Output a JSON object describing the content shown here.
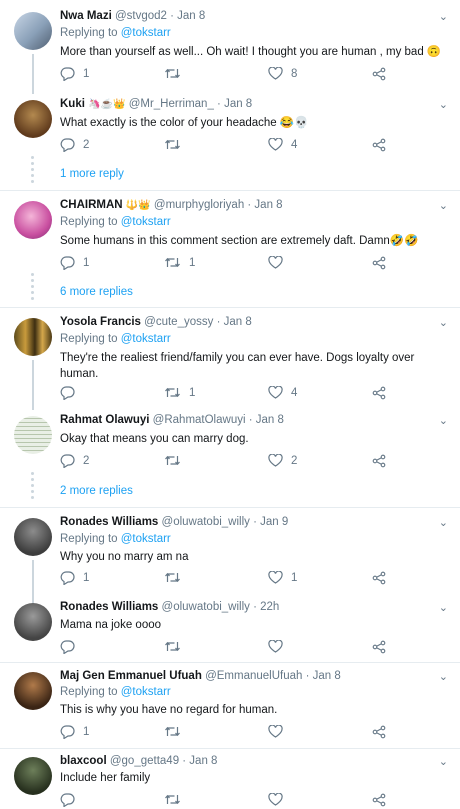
{
  "icons": {
    "reply": "speech-bubble-icon",
    "retweet": "retweet-arrows-icon",
    "like": "heart-icon",
    "share": "share-nodes-icon",
    "menu": "chevron-down-icon"
  },
  "colors": {
    "link": "#1da1f2",
    "secondary": "#657786",
    "divider": "#e6ecf0"
  },
  "tweets": [
    {
      "name": "Nwa Mazi",
      "emoji": "",
      "handle": "@stvgod2 · Jan 8",
      "replying_label": "Replying to",
      "replying_to": "@tokstarr",
      "text": "More than yourself as well... Oh wait!  I thought you are human , my bad 🙃",
      "replies": "1",
      "retweets": "",
      "likes": "8"
    },
    {
      "name": "Kuki",
      "emoji": "🦄☕👑",
      "handle": "@Mr_Herriman_ · Jan 8",
      "replying_label": "",
      "replying_to": "",
      "text": "What exactly is the color of your headache 😂💀",
      "replies": "2",
      "retweets": "",
      "likes": "4",
      "more": "1 more reply"
    },
    {
      "name": "CHAIRMAN",
      "emoji": "🔱👑",
      "handle": "@murphygloriyah · Jan 8",
      "replying_label": "Replying to",
      "replying_to": "@tokstarr",
      "text": "Some humans in this comment section are extremely daft. Damn🤣🤣",
      "replies": "1",
      "retweets": "1",
      "likes": "",
      "more": "6 more replies"
    },
    {
      "name": "Yosola Francis",
      "emoji": "",
      "handle": "@cute_yossy · Jan 8",
      "replying_label": "Replying to",
      "replying_to": "@tokstarr",
      "text": "They're the realiest friend/family you can ever have. Dogs loyalty over human.",
      "replies": "",
      "retweets": "1",
      "likes": "4"
    },
    {
      "name": "Rahmat Olawuyi",
      "emoji": "",
      "handle": "@RahmatOlawuyi · Jan 8",
      "replying_label": "",
      "replying_to": "",
      "text": "Okay that means you can marry dog.",
      "replies": "2",
      "retweets": "",
      "likes": "2",
      "more": "2 more replies"
    },
    {
      "name": "Ronades Williams",
      "emoji": "",
      "handle": "@oluwatobi_willy · Jan 9",
      "replying_label": "Replying to",
      "replying_to": "@tokstarr",
      "text": "Why you no marry am na",
      "replies": "1",
      "retweets": "",
      "likes": "1"
    },
    {
      "name": "Ronades Williams",
      "emoji": "",
      "handle": "@oluwatobi_willy · 22h",
      "replying_label": "",
      "replying_to": "",
      "text": "Mama na joke oooo",
      "replies": "",
      "retweets": "",
      "likes": ""
    },
    {
      "name": "Maj Gen Emmanuel Ufuah",
      "emoji": "",
      "handle": "@EmmanuelUfuah · Jan 8",
      "replying_label": "Replying to",
      "replying_to": "@tokstarr",
      "text": "This is why you have no regard for human.",
      "replies": "1",
      "retweets": "",
      "likes": ""
    },
    {
      "name": "blaxcool",
      "emoji": "",
      "handle": "@go_getta49 · Jan 8",
      "replying_label": "",
      "replying_to": "",
      "text": "Include her family",
      "replies": "",
      "retweets": "",
      "likes": ""
    }
  ]
}
